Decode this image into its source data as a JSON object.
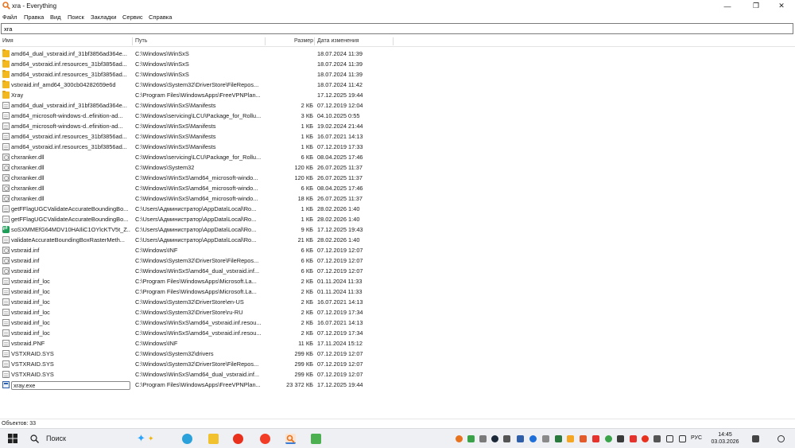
{
  "window": {
    "title": "xra - Everything",
    "minimize": "—",
    "maximize": "❐",
    "close": "✕"
  },
  "menu": [
    "Файл",
    "Правка",
    "Вид",
    "Поиск",
    "Закладки",
    "Сервис",
    "Справка"
  ],
  "search": {
    "value": "xra"
  },
  "columns": {
    "name": "Имя",
    "path": "Путь",
    "size": "Размер",
    "date": "Дата изменения"
  },
  "rows": [
    {
      "icon": "folder-icon",
      "name": "amd64_dual_vstxraid.inf_31bf3856ad364e...",
      "path": "C:\\Windows\\WinSxS",
      "size": "",
      "date": "18.07.2024 11:39"
    },
    {
      "icon": "folder-icon",
      "name": "amd64_vstxraid.inf.resources_31bf3856ad...",
      "path": "C:\\Windows\\WinSxS",
      "size": "",
      "date": "18.07.2024 11:39"
    },
    {
      "icon": "folder-icon",
      "name": "amd64_vstxraid.inf.resources_31bf3856ad...",
      "path": "C:\\Windows\\WinSxS",
      "size": "",
      "date": "18.07.2024 11:39"
    },
    {
      "icon": "folder-icon",
      "name": "vstxraid.inf_amd64_300cb04282659e6d",
      "path": "C:\\Windows\\System32\\DriverStore\\FileRepos...",
      "size": "",
      "date": "18.07.2024 11:42"
    },
    {
      "icon": "folder-icon",
      "name": "Xray",
      "path": "C:\\Program Files\\WindowsApps\\FreeVPNPlan...",
      "size": "",
      "date": "17.12.2025 19:44"
    },
    {
      "icon": "document-icon",
      "name": "amd64_dual_vstxraid.inf_31bf3856ad364e...",
      "path": "C:\\Windows\\WinSxS\\Manifests",
      "size": "2 КБ",
      "date": "07.12.2019 12:04"
    },
    {
      "icon": "document-icon",
      "name": "amd64_microsoft-windows-d..efinition-ad...",
      "path": "C:\\Windows\\servicing\\LCU\\Package_for_Rollu...",
      "size": "3 КБ",
      "date": "04.10.2025 0:55"
    },
    {
      "icon": "document-icon",
      "name": "amd64_microsoft-windows-d..efinition-ad...",
      "path": "C:\\Windows\\WinSxS\\Manifests",
      "size": "1 КБ",
      "date": "19.02.2024 21:44"
    },
    {
      "icon": "document-icon",
      "name": "amd64_vstxraid.inf.resources_31bf3856ad...",
      "path": "C:\\Windows\\WinSxS\\Manifests",
      "size": "1 КБ",
      "date": "16.07.2021 14:13"
    },
    {
      "icon": "document-icon",
      "name": "amd64_vstxraid.inf.resources_31bf3856ad...",
      "path": "C:\\Windows\\WinSxS\\Manifests",
      "size": "1 КБ",
      "date": "07.12.2019 17:33"
    },
    {
      "icon": "dll-icon",
      "name": "chxranker.dll",
      "path": "C:\\Windows\\servicing\\LCU\\Package_for_Rollu...",
      "size": "6 КБ",
      "date": "08.04.2025 17:46"
    },
    {
      "icon": "dll-icon",
      "name": "chxranker.dll",
      "path": "C:\\Windows\\System32",
      "size": "120 КБ",
      "date": "26.07.2025 11:37"
    },
    {
      "icon": "dll-icon",
      "name": "chxranker.dll",
      "path": "C:\\Windows\\WinSxS\\amd64_microsoft-windo...",
      "size": "120 КБ",
      "date": "26.07.2025 11:37"
    },
    {
      "icon": "dll-icon",
      "name": "chxranker.dll",
      "path": "C:\\Windows\\WinSxS\\amd64_microsoft-windo...",
      "size": "6 КБ",
      "date": "08.04.2025 17:46"
    },
    {
      "icon": "dll-icon",
      "name": "chxranker.dll",
      "path": "C:\\Windows\\WinSxS\\amd64_microsoft-windo...",
      "size": "18 КБ",
      "date": "26.07.2025 11:37"
    },
    {
      "icon": "document-icon",
      "name": "getFFlagUGCValidateAccurateBoundingBo...",
      "path": "C:\\Users\\Администратор\\AppData\\Local\\Ro...",
      "size": "1 КБ",
      "date": "28.02.2026 1:40"
    },
    {
      "icon": "document-icon",
      "name": "getFFlagUGCValidateAccurateBoundingBo...",
      "path": "C:\\Users\\Администратор\\AppData\\Local\\Ro...",
      "size": "1 КБ",
      "date": "28.02.2026 1:40"
    },
    {
      "icon": "green-app-icon",
      "name": "soSXMMEfG64MDV10HAIliC1OYlcKTV5t_Z...",
      "path": "C:\\Users\\Администратор\\AppData\\Local\\Ro...",
      "size": "9 КБ",
      "date": "17.12.2025 19:43"
    },
    {
      "icon": "document-icon",
      "name": "validateAccurateBoundingBoxRasterMeth...",
      "path": "C:\\Users\\Администратор\\AppData\\Local\\Ro...",
      "size": "21 КБ",
      "date": "28.02.2026 1:40"
    },
    {
      "icon": "dll-icon",
      "name": "vstxraid.inf",
      "path": "C:\\Windows\\INF",
      "size": "6 КБ",
      "date": "07.12.2019 12:07"
    },
    {
      "icon": "dll-icon",
      "name": "vstxraid.inf",
      "path": "C:\\Windows\\System32\\DriverStore\\FileRepos...",
      "size": "6 КБ",
      "date": "07.12.2019 12:07"
    },
    {
      "icon": "dll-icon",
      "name": "vstxraid.inf",
      "path": "C:\\Windows\\WinSxS\\amd64_dual_vstxraid.inf...",
      "size": "6 КБ",
      "date": "07.12.2019 12:07"
    },
    {
      "icon": "document-icon",
      "name": "vstxraid.inf_loc",
      "path": "C:\\Program Files\\WindowsApps\\Microsoft.La...",
      "size": "2 КБ",
      "date": "01.11.2024 11:33"
    },
    {
      "icon": "document-icon",
      "name": "vstxraid.inf_loc",
      "path": "C:\\Program Files\\WindowsApps\\Microsoft.La...",
      "size": "2 КБ",
      "date": "01.11.2024 11:33"
    },
    {
      "icon": "document-icon",
      "name": "vstxraid.inf_loc",
      "path": "C:\\Windows\\System32\\DriverStore\\en-US",
      "size": "2 КБ",
      "date": "16.07.2021 14:13"
    },
    {
      "icon": "document-icon",
      "name": "vstxraid.inf_loc",
      "path": "C:\\Windows\\System32\\DriverStore\\ru-RU",
      "size": "2 КБ",
      "date": "07.12.2019 17:34"
    },
    {
      "icon": "document-icon",
      "name": "vstxraid.inf_loc",
      "path": "C:\\Windows\\WinSxS\\amd64_vstxraid.inf.resou...",
      "size": "2 КБ",
      "date": "16.07.2021 14:13"
    },
    {
      "icon": "document-icon",
      "name": "vstxraid.inf_loc",
      "path": "C:\\Windows\\WinSxS\\amd64_vstxraid.inf.resou...",
      "size": "2 КБ",
      "date": "07.12.2019 17:34"
    },
    {
      "icon": "document-icon",
      "name": "vstxraid.PNF",
      "path": "C:\\Windows\\INF",
      "size": "11 КБ",
      "date": "17.11.2024 15:12"
    },
    {
      "icon": "document-icon",
      "name": "VSTXRAID.SYS",
      "path": "C:\\Windows\\System32\\drivers",
      "size": "299 КБ",
      "date": "07.12.2019 12:07"
    },
    {
      "icon": "document-icon",
      "name": "VSTXRAID.SYS",
      "path": "C:\\Windows\\System32\\DriverStore\\FileRepos...",
      "size": "299 КБ",
      "date": "07.12.2019 12:07"
    },
    {
      "icon": "document-icon",
      "name": "VSTXRAID.SYS",
      "path": "C:\\Windows\\WinSxS\\amd64_dual_vstxraid.inf...",
      "size": "299 КБ",
      "date": "07.12.2019 12:07"
    },
    {
      "icon": "exe-icon",
      "name": "xray.exe",
      "path": "C:\\Program Files\\WindowsApps\\FreeVPNPlan...",
      "size": "23 372 КБ",
      "date": "17.12.2025 19:44"
    }
  ],
  "status": {
    "text": "Объектов: 33"
  },
  "taskbar": {
    "search_label": "Поиск",
    "language": "РУС",
    "time": "14:45",
    "date": "03.03.2026"
  },
  "colors": {
    "folder": "#f4b81f",
    "accent_orange": "#e8731e",
    "taskbar_bg": "#eef0f4"
  }
}
